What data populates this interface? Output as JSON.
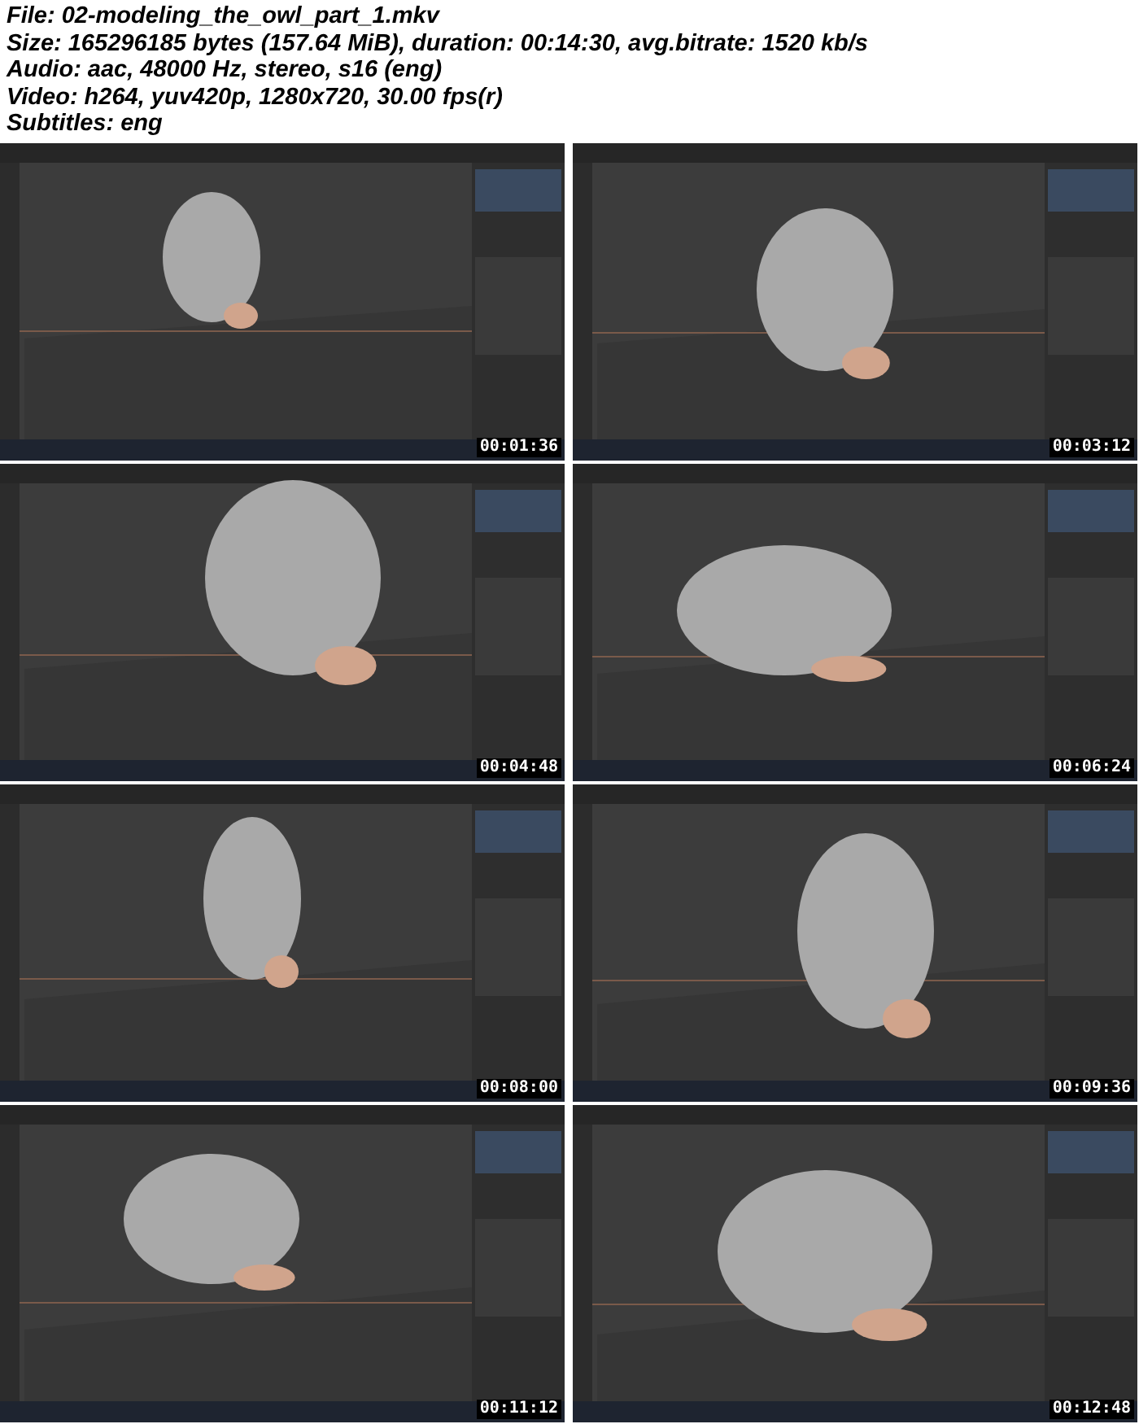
{
  "header": [
    "File: 02-modeling_the_owl_part_1.mkv",
    "Size: 165296185 bytes (157.64 MiB), duration: 00:14:30, avg.bitrate: 1520 kb/s",
    "Audio: aac, 48000 Hz, stereo, s16 (eng)",
    "Video: h264, yuv420p, 1280x720, 30.00 fps(r)",
    "Subtitles: eng"
  ],
  "frames": [
    {
      "timestamp": "00:01:36"
    },
    {
      "timestamp": "00:03:12"
    },
    {
      "timestamp": "00:04:48"
    },
    {
      "timestamp": "00:06:24"
    },
    {
      "timestamp": "00:08:00"
    },
    {
      "timestamp": "00:09:36"
    },
    {
      "timestamp": "00:11:12"
    },
    {
      "timestamp": "00:12:48"
    }
  ]
}
